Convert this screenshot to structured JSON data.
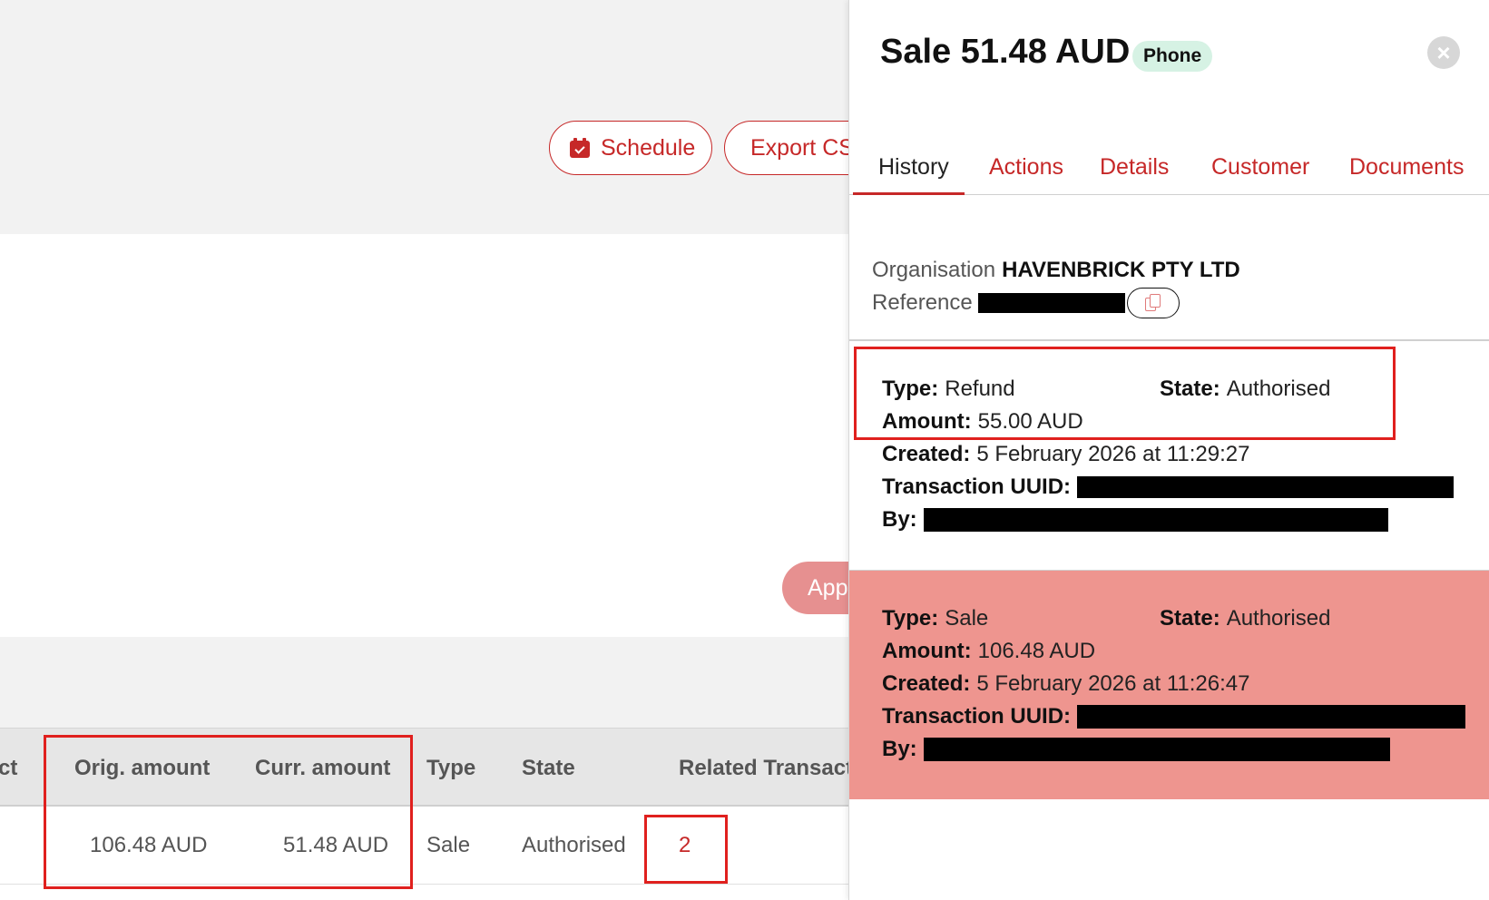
{
  "background": {
    "toolbar": {
      "schedule_label": "Schedule",
      "export_label": "Export CSV"
    },
    "apply_label": "Apply",
    "table": {
      "headers": [
        "ct",
        "Orig. amount",
        "Curr. amount",
        "Type",
        "State",
        "Related Transactions"
      ],
      "row": {
        "orig_amount": "106.48 AUD",
        "curr_amount": "51.48 AUD",
        "type": "Sale",
        "state": "Authorised",
        "related": "2"
      }
    }
  },
  "panel": {
    "title": "Sale 51.48 AUD",
    "badge": "Phone",
    "close_symbol": "×",
    "tabs": [
      "History",
      "Actions",
      "Details",
      "Customer",
      "Documents"
    ],
    "active_tab": "History",
    "organisation_label": "Organisation",
    "organisation_value": "HAVENBRICK PTY LTD",
    "reference_label": "Reference",
    "history": [
      {
        "type_label": "Type:",
        "type": "Refund",
        "state_label": "State:",
        "state": "Authorised",
        "amount_label": "Amount:",
        "amount": "55.00 AUD",
        "created_label": "Created:",
        "created": "5 February 2026 at 11:29:27",
        "uuid_label": "Transaction UUID:",
        "by_label": "By:"
      },
      {
        "type_label": "Type:",
        "type": "Sale",
        "state_label": "State:",
        "state": "Authorised",
        "amount_label": "Amount:",
        "amount": "106.48 AUD",
        "created_label": "Created:",
        "created": "5 February 2026 at 11:26:47",
        "uuid_label": "Transaction UUID:",
        "by_label": "By:"
      }
    ]
  },
  "colors": {
    "accent": "#c62828",
    "highlight_box": "#e0201e",
    "sale_entry_bg": "#ee958f",
    "badge_bg": "#d6f2e4"
  }
}
